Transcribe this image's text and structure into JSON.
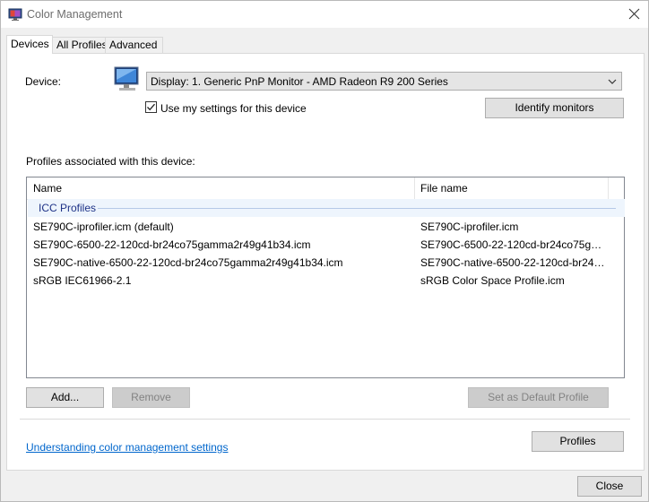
{
  "window": {
    "title": "Color Management",
    "close_tooltip": "Close"
  },
  "tabs": [
    {
      "label": "Devices"
    },
    {
      "label": "All Profiles"
    },
    {
      "label": "Advanced"
    }
  ],
  "device": {
    "label": "Device:",
    "selected": "Display: 1. Generic PnP Monitor - AMD Radeon R9 200 Series",
    "use_my_settings_label": "Use my settings for this device",
    "use_my_settings_checked": true,
    "identify_button": "Identify monitors"
  },
  "profiles": {
    "section_label": "Profiles associated with this device:",
    "columns": {
      "name": "Name",
      "file": "File name"
    },
    "group_label": "ICC Profiles",
    "rows": [
      {
        "name": "SE790C-iprofiler.icm (default)",
        "file": "SE790C-iprofiler.icm"
      },
      {
        "name": "SE790C-6500-22-120cd-br24co75gamma2r49g41b34.icm",
        "file": "SE790C-6500-22-120cd-br24co75ga..."
      },
      {
        "name": "SE790C-native-6500-22-120cd-br24co75gamma2r49g41b34.icm",
        "file": "SE790C-native-6500-22-120cd-br24c..."
      },
      {
        "name": "sRGB IEC61966-2.1",
        "file": "sRGB Color Space Profile.icm"
      }
    ]
  },
  "buttons": {
    "add": "Add...",
    "remove": "Remove",
    "set_default": "Set as Default Profile",
    "profiles": "Profiles",
    "close": "Close"
  },
  "link": "Understanding color management settings"
}
